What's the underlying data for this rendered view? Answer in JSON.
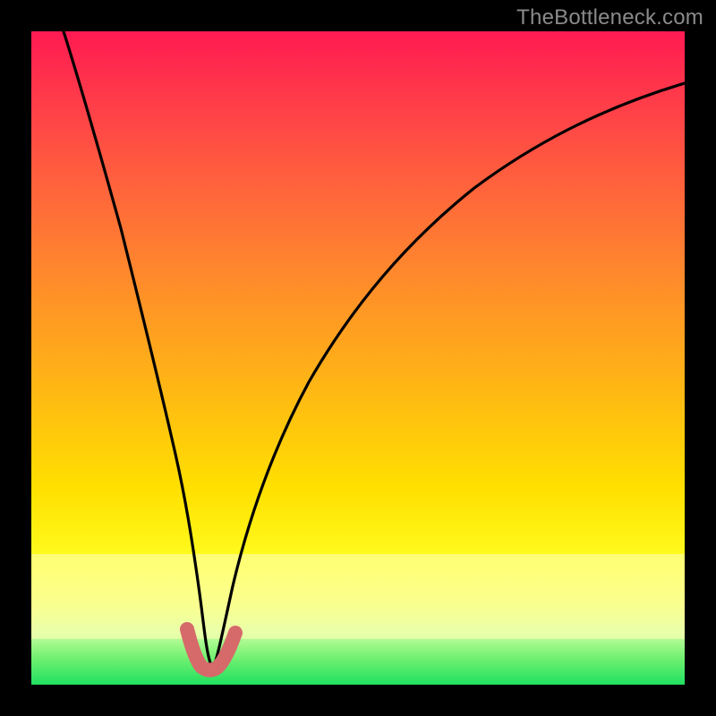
{
  "watermark": "TheBottleneck.com",
  "chart_data": {
    "type": "line",
    "title": "",
    "xlabel": "",
    "ylabel": "",
    "xlim": [
      0,
      100
    ],
    "ylim": [
      0,
      100
    ],
    "notes": "Plot-area gradient: red (high y / bottleneck) → yellow → green (low y / balanced). Curve is bottleneck-style V with minimum near x≈27. Pink marker segment near minimum. Axes unlabeled; values are position estimates in % of plot area (x left→right, y bottom→top).",
    "series": [
      {
        "name": "bottleneck-curve",
        "x": [
          5,
          8,
          11,
          14,
          17,
          20,
          22,
          24,
          25.5,
          27,
          28.5,
          30,
          32,
          35,
          40,
          46,
          54,
          64,
          76,
          90,
          100
        ],
        "y": [
          100,
          90,
          79,
          67,
          54,
          40,
          29,
          18,
          10,
          4,
          10,
          17,
          25,
          34,
          44,
          53,
          62,
          70,
          77,
          83,
          87
        ]
      },
      {
        "name": "pink-marker-segment",
        "x": [
          23.5,
          24.5,
          25.5,
          27,
          28.5,
          29.5,
          31
        ],
        "y": [
          8,
          5.5,
          3.5,
          3,
          3.5,
          5,
          8
        ]
      }
    ]
  }
}
